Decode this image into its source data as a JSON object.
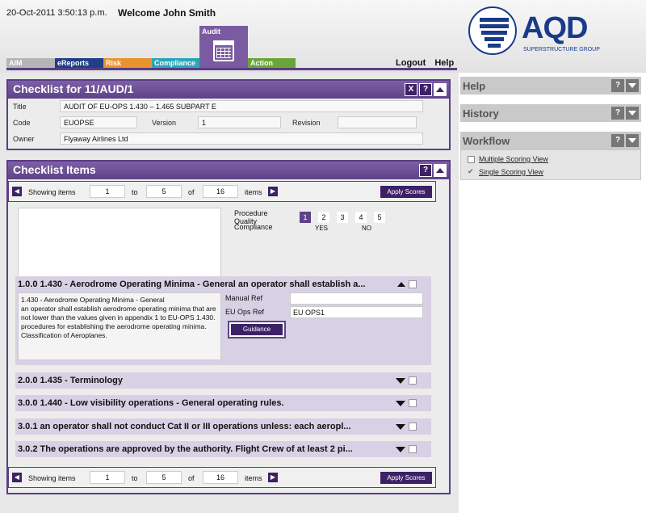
{
  "header": {
    "datetime": "20-Oct-2011 3:50:13 p.m.",
    "welcome": "Welcome John Smith",
    "tabs": [
      {
        "label": "AIM",
        "color": "#b5b5b5"
      },
      {
        "label": "eReports",
        "color": "#1f3f86"
      },
      {
        "label": "Risk",
        "color": "#e8932e"
      },
      {
        "label": "Compliance",
        "color": "#2aa6b8"
      },
      {
        "label": "Action",
        "color": "#6aa53a"
      }
    ],
    "audit_tab": "Audit",
    "logout": "Logout",
    "help": "Help"
  },
  "logo": {
    "name": "AQD",
    "subtitle": "SUPERSTRUCTURE GROUP"
  },
  "checklist": {
    "title": "Checklist for 11/AUD/1",
    "close_btn": "X",
    "help_btn": "?",
    "fields": {
      "title_label": "Title",
      "title_value": "AUDIT OF EU-OPS 1.430 – 1.465   SUBPART E",
      "code_label": "Code",
      "code_value": "EUOPSE",
      "version_label": "Version",
      "version_value": "1",
      "revision_label": "Revision",
      "revision_value": "",
      "owner_label": "Owner",
      "owner_value": "Flyaway Airlines Ltd"
    }
  },
  "items_panel": {
    "title": "Checklist Items",
    "help_btn": "?",
    "pager": {
      "showing": "Showing items",
      "from": "1",
      "to_label": "to",
      "to": "5",
      "of_label": "of",
      "total": "16",
      "items_label": "items",
      "apply": "Apply Scores"
    },
    "procedure_quality_label": "Procedure Quality",
    "quality_options": [
      "1",
      "2",
      "3",
      "4",
      "5"
    ],
    "compliance_label": "Compliance",
    "compliance_yes": "YES",
    "compliance_no": "NO",
    "expanded_item": {
      "title": "1.0.0 1.430 - Aerodrome Operating Minima - General an operator shall establish a...",
      "desc_1": "1.430 - Aerodrome Operating Minima - General",
      "desc_2": "an operator shall establish aerodrome operating minima that are not lower than the values given in appendix 1 to EU-OPS 1.430.",
      "desc_3": "procedures for establishing the aerodrome operating minima.",
      "desc_4": "Classification of Aeroplanes.",
      "manual_ref_label": "Manual Ref",
      "manual_ref_value": "",
      "eu_ops_ref_label": "EU Ops Ref",
      "eu_ops_ref_value": "EU OPS1",
      "guidance": "Guidance"
    },
    "collapsed_items": [
      "2.0.0 1.435 - Terminology",
      "3.0.0 1.440 - Low visibility operations - General operating rules.",
      "3.0.1 an operator shall not conduct Cat II or III operations unless: each aeropl...",
      "3.0.2 The operations are approved by the authority. Flight Crew of at least 2 pi..."
    ]
  },
  "side": {
    "help": "Help",
    "history": "History",
    "workflow": "Workflow",
    "help_btn": "?",
    "workflow_items": [
      "Multiple Scoring View",
      "Single Scoring View"
    ]
  }
}
